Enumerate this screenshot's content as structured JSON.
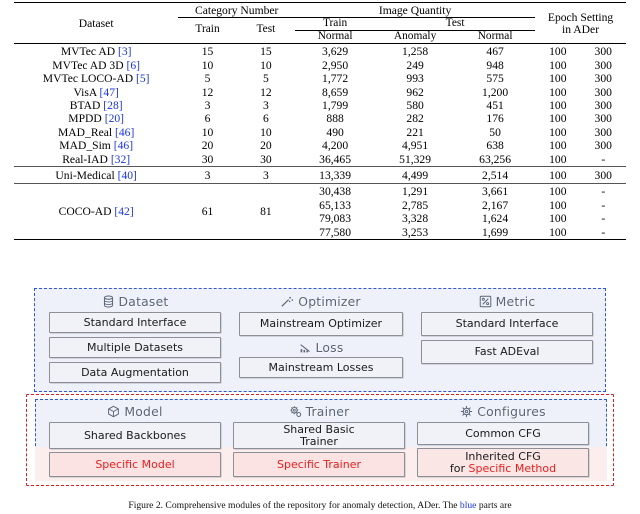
{
  "table": {
    "headers": {
      "dataset": "Dataset",
      "category_number": "Category Number",
      "category_train": "Train",
      "category_test": "Test",
      "image_quantity": "Image Quantity",
      "img_train": "Train",
      "img_train_normal": "Normal",
      "img_test": "Test",
      "img_test_anomaly": "Anomaly",
      "img_test_normal": "Normal",
      "epoch_setting_line1": "Epoch Setting",
      "epoch_setting_line2": "in ADer"
    },
    "rows": [
      {
        "name": "MVTec AD",
        "cite": "[3]",
        "cat_train": "15",
        "cat_test": "15",
        "train_normal": "3,629",
        "test_anomaly": "1,258",
        "test_normal": "467",
        "epoch1": "100",
        "epoch2": "300"
      },
      {
        "name": "MVTec AD 3D",
        "cite": "[6]",
        "cat_train": "10",
        "cat_test": "10",
        "train_normal": "2,950",
        "test_anomaly": "249",
        "test_normal": "948",
        "epoch1": "100",
        "epoch2": "300"
      },
      {
        "name": "MVTec LOCO-AD",
        "cite": "[5]",
        "cat_train": "5",
        "cat_test": "5",
        "train_normal": "1,772",
        "test_anomaly": "993",
        "test_normal": "575",
        "epoch1": "100",
        "epoch2": "300"
      },
      {
        "name": "VisA",
        "cite": "[47]",
        "cat_train": "12",
        "cat_test": "12",
        "train_normal": "8,659",
        "test_anomaly": "962",
        "test_normal": "1,200",
        "epoch1": "100",
        "epoch2": "300"
      },
      {
        "name": "BTAD",
        "cite": "[28]",
        "cat_train": "3",
        "cat_test": "3",
        "train_normal": "1,799",
        "test_anomaly": "580",
        "test_normal": "451",
        "epoch1": "100",
        "epoch2": "300"
      },
      {
        "name": "MPDD",
        "cite": "[20]",
        "cat_train": "6",
        "cat_test": "6",
        "train_normal": "888",
        "test_anomaly": "282",
        "test_normal": "176",
        "epoch1": "100",
        "epoch2": "300"
      },
      {
        "name": "MAD_Real",
        "cite": "[46]",
        "cat_train": "10",
        "cat_test": "10",
        "train_normal": "490",
        "test_anomaly": "221",
        "test_normal": "50",
        "epoch1": "100",
        "epoch2": "300"
      },
      {
        "name": "MAD_Sim",
        "cite": "[46]",
        "cat_train": "20",
        "cat_test": "20",
        "train_normal": "4,200",
        "test_anomaly": "4,951",
        "test_normal": "638",
        "epoch1": "100",
        "epoch2": "300"
      },
      {
        "name": "Real-IAD",
        "cite": "[32]",
        "cat_train": "30",
        "cat_test": "30",
        "train_normal": "36,465",
        "test_anomaly": "51,329",
        "test_normal": "63,256",
        "epoch1": "100",
        "epoch2": "-"
      }
    ],
    "unimedical": {
      "name": "Uni-Medical",
      "cite": "[40]",
      "cat_train": "3",
      "cat_test": "3",
      "train_normal": "13,339",
      "test_anomaly": "4,499",
      "test_normal": "2,514",
      "epoch1": "100",
      "epoch2": "300"
    },
    "coco": {
      "name": "COCO-AD",
      "cite": "[42]",
      "cat_train": "61",
      "cat_test": "81",
      "subrows": [
        {
          "train_normal": "30,438",
          "test_anomaly": "1,291",
          "test_normal": "3,661",
          "epoch1": "100",
          "epoch2": "-"
        },
        {
          "train_normal": "65,133",
          "test_anomaly": "2,785",
          "test_normal": "2,167",
          "epoch1": "100",
          "epoch2": "-"
        },
        {
          "train_normal": "79,083",
          "test_anomaly": "3,328",
          "test_normal": "1,624",
          "epoch1": "100",
          "epoch2": "-"
        },
        {
          "train_normal": "77,580",
          "test_anomaly": "3,253",
          "test_normal": "1,699",
          "epoch1": "100",
          "epoch2": "-"
        }
      ]
    }
  },
  "diagram": {
    "top_panel": {
      "dataset": {
        "title": "Dataset",
        "icon": "database-icon",
        "boxes": [
          "Standard Interface",
          "Multiple Datasets",
          "Data Augmentation"
        ]
      },
      "optimizer": {
        "title": "Optimizer",
        "icon": "magic-wand-icon",
        "boxes": [
          "Mainstream Optimizer"
        ]
      },
      "loss": {
        "title": "Loss",
        "icon": "declining-chart-icon",
        "boxes": [
          "Mainstream Losses"
        ]
      },
      "metric": {
        "title": "Metric",
        "icon": "percent-chart-icon",
        "boxes": [
          "Standard Interface",
          "Fast ADEval"
        ]
      }
    },
    "bottom_panel": {
      "model": {
        "title": "Model",
        "icon": "cube-icon",
        "shared_box": "Shared Backbones",
        "specific_box": "Specific Model"
      },
      "trainer": {
        "title": "Trainer",
        "icon": "gear-cog-icon",
        "shared_box_line1": "Shared Basic",
        "shared_box_line2": "Trainer",
        "specific_box": "Specific Trainer"
      },
      "configures": {
        "title": "Configures",
        "icon": "gear-icon",
        "common_box": "Common CFG",
        "inherited_line1": "Inherited CFG",
        "inherited_line2_prefix": "for ",
        "inherited_line2_accent": "Specific Method"
      }
    },
    "colors": {
      "panel_fill": "#eef1f9",
      "blue_dashed": "#2b57d8",
      "red_dashed": "#e01b1b",
      "accent_red": "#e8201e",
      "pink_fill": "#fbe3e3",
      "box_fill": "#f0f2f8",
      "box_border": "#8c8f96",
      "title_gray": "#5a6475",
      "citation_blue": "#1a35e0"
    }
  },
  "caption": {
    "prefix": "Figure 2. Comprehensive modules of the repository for anomaly detection, ADer. The ",
    "accent": "blue",
    "suffix": " parts are"
  }
}
